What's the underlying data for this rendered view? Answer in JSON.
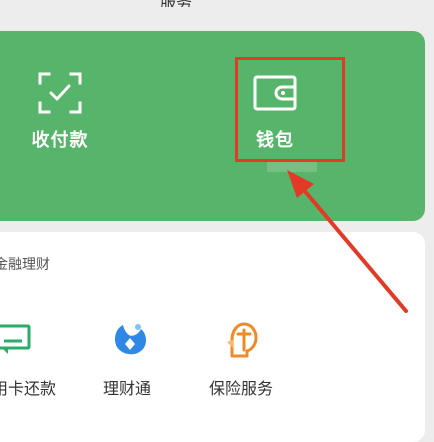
{
  "header": {
    "title_fragment": "服务"
  },
  "pay_section": {
    "background_color": "#57b46b",
    "receive_payment": {
      "label": "收付款",
      "icon": "scan-check-icon"
    },
    "wallet": {
      "label": "钱包",
      "icon": "wallet-icon"
    }
  },
  "finance_section": {
    "title": "金融理财",
    "items": [
      {
        "label": "信用卡还款",
        "icon": "credit-card-icon",
        "color": "#2aae67"
      },
      {
        "label": "理财通",
        "icon": "licaitong-icon",
        "color": "#2f88e5"
      },
      {
        "label": "保险服务",
        "icon": "insurance-icon",
        "color": "#f08a24"
      }
    ]
  },
  "annotation": {
    "highlight_color": "#e23a26",
    "arrow_color": "#e23a26"
  }
}
